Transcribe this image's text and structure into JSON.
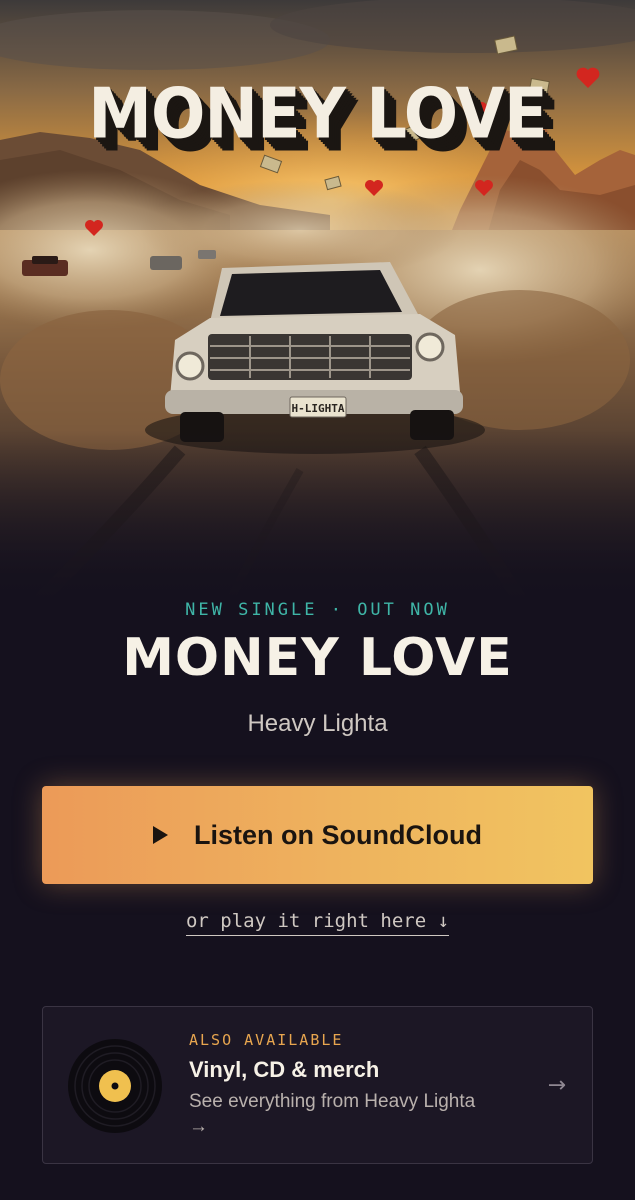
{
  "hero": {
    "art_title": "MONEY LOVE",
    "plate": "H-LIGHTA"
  },
  "release": {
    "eyebrow": "NEW SINGLE · OUT NOW",
    "title": "MONEY LOVE",
    "artist": "Heavy Lighta"
  },
  "actions": {
    "listen_label": "Listen on SoundCloud",
    "alt_link": "or play it right here ↓"
  },
  "card": {
    "eyebrow": "ALSO AVAILABLE",
    "title": "Vinyl, CD & merch",
    "subtitle": "See everything from Heavy Lighta",
    "sub_arrow": "→",
    "arrow": "→"
  },
  "colors": {
    "background": "#15111e",
    "accent_teal": "#3fb5a7",
    "button_gradient_start": "#ec9a58",
    "button_gradient_end": "#f1c460",
    "card_eyebrow": "#e8a64f"
  },
  "icons": {
    "play": "play-icon",
    "vinyl": "vinyl-record-icon",
    "arrow": "arrow-right-icon"
  }
}
